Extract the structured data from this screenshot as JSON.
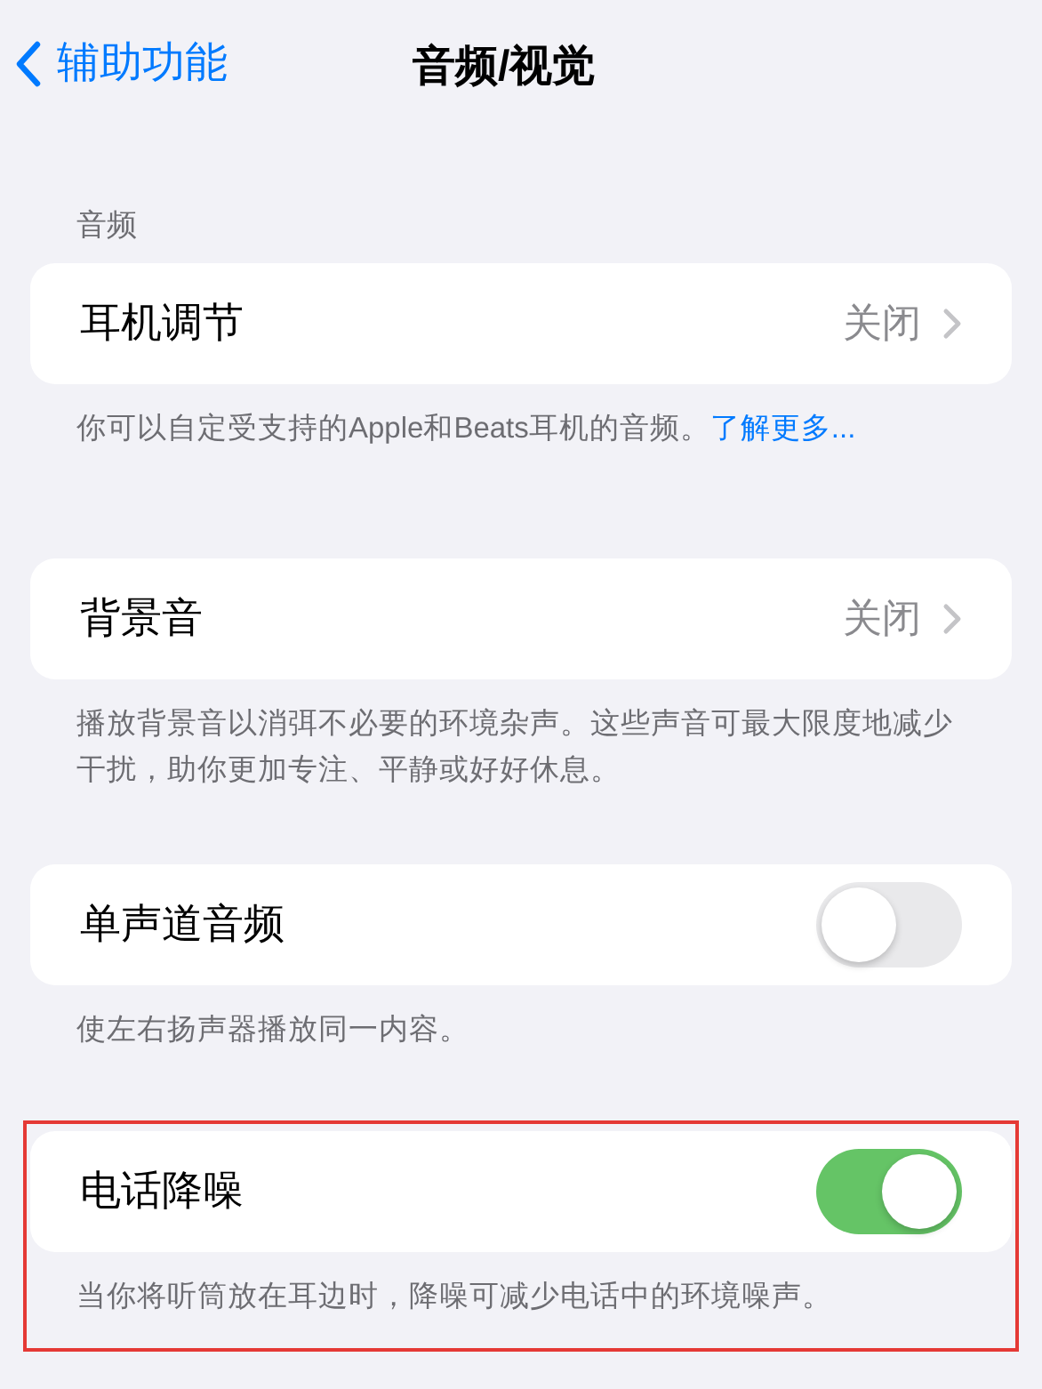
{
  "nav": {
    "back": "辅助功能",
    "title": "音频/视觉"
  },
  "sections": [
    {
      "header": "音频",
      "row": {
        "kind": "value",
        "label": "耳机调节",
        "value": "关闭"
      },
      "footer": "你可以自定受支持的Apple和Beats耳机的音频。",
      "footer_link": "了解更多...",
      "highlighted": false
    },
    {
      "row": {
        "kind": "value",
        "label": "背景音",
        "value": "关闭"
      },
      "footer": "播放背景音以消弭不必要的环境杂声。这些声音可最大限度地减少干扰，助你更加专注、平静或好好休息。",
      "highlighted": false
    },
    {
      "row": {
        "kind": "toggle",
        "label": "单声道音频",
        "on": false
      },
      "footer": "使左右扬声器播放同一内容。",
      "highlighted": false
    },
    {
      "row": {
        "kind": "toggle",
        "label": "电话降噪",
        "on": true
      },
      "footer": "当你将听筒放在耳边时，降噪可减少电话中的环境噪声。",
      "highlighted": true
    }
  ]
}
